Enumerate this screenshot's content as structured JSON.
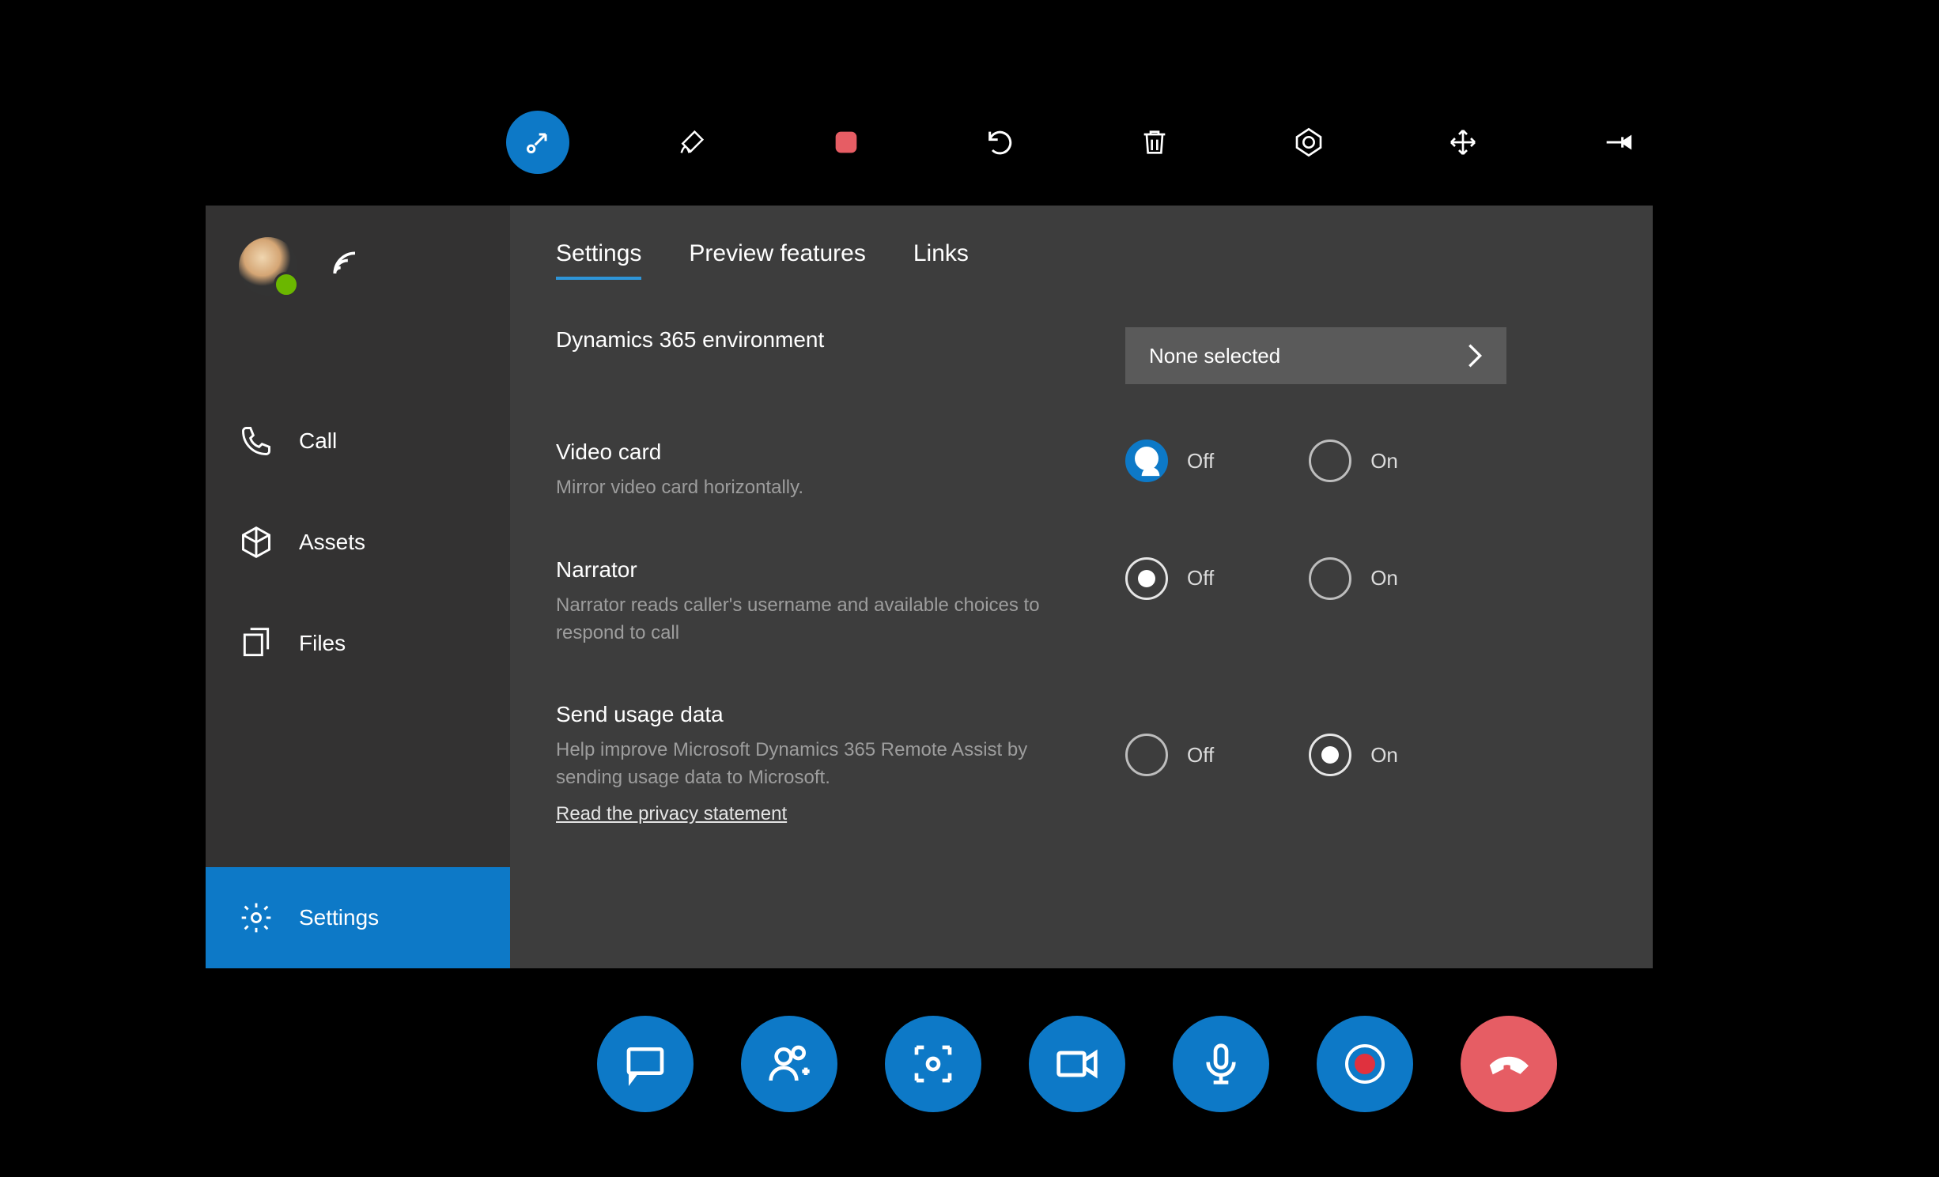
{
  "topToolbar": {
    "items": [
      "collapse",
      "draw",
      "stop",
      "undo",
      "trash",
      "color",
      "arrows",
      "pin"
    ]
  },
  "sidebar": {
    "nav": {
      "call": "Call",
      "assets": "Assets",
      "files": "Files",
      "settings": "Settings"
    }
  },
  "tabs": {
    "settings": "Settings",
    "preview": "Preview features",
    "links": "Links"
  },
  "settings": {
    "env": {
      "title": "Dynamics 365 environment",
      "value": "None selected"
    },
    "video": {
      "title": "Video card",
      "sub": "Mirror video card horizontally.",
      "off": "Off",
      "on": "On"
    },
    "narrator": {
      "title": "Narrator",
      "sub": "Narrator reads caller's username and available choices to respond to call",
      "off": "Off",
      "on": "On"
    },
    "usage": {
      "title": "Send usage data",
      "sub": "Help improve Microsoft Dynamics 365 Remote Assist by sending usage data to Microsoft.",
      "link": "Read the privacy statement",
      "off": "Off",
      "on": "On"
    }
  },
  "callbar": {
    "items": [
      "chat",
      "add-people",
      "capture",
      "video",
      "mic",
      "record",
      "hangup"
    ]
  }
}
